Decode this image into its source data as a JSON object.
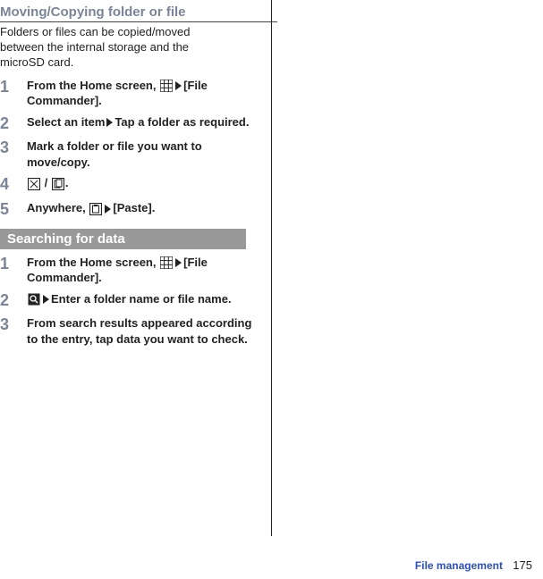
{
  "section1": {
    "title": "Moving/Copying folder or file",
    "intro": "Folders or files can be copied/moved between the internal storage and the microSD card.",
    "steps": [
      {
        "num": "1",
        "pre": "From the Home screen, ",
        "icon": "apps",
        "post": "[File Commander]."
      },
      {
        "num": "2",
        "pre": "Select an item",
        "icon": "tri",
        "post": "Tap a folder as required."
      },
      {
        "num": "3",
        "pre": "Mark a folder or file you want to move/copy.",
        "icon": "",
        "post": ""
      },
      {
        "num": "4",
        "pre": "",
        "icon": "cutcopy",
        "post": "."
      },
      {
        "num": "5",
        "pre": "Anywhere, ",
        "icon": "paste",
        "post": "[Paste]."
      }
    ]
  },
  "section2": {
    "title": "Searching for data",
    "steps": [
      {
        "num": "1",
        "pre": "From the Home screen, ",
        "icon": "apps",
        "post": "[File Commander]."
      },
      {
        "num": "2",
        "pre": "",
        "icon": "search",
        "post": "Enter a folder name or file name."
      },
      {
        "num": "3",
        "pre": "From search results appeared according to the entry, tap data you want to check.",
        "icon": "",
        "post": ""
      }
    ]
  },
  "footer": {
    "category": "File management",
    "page": "175"
  }
}
